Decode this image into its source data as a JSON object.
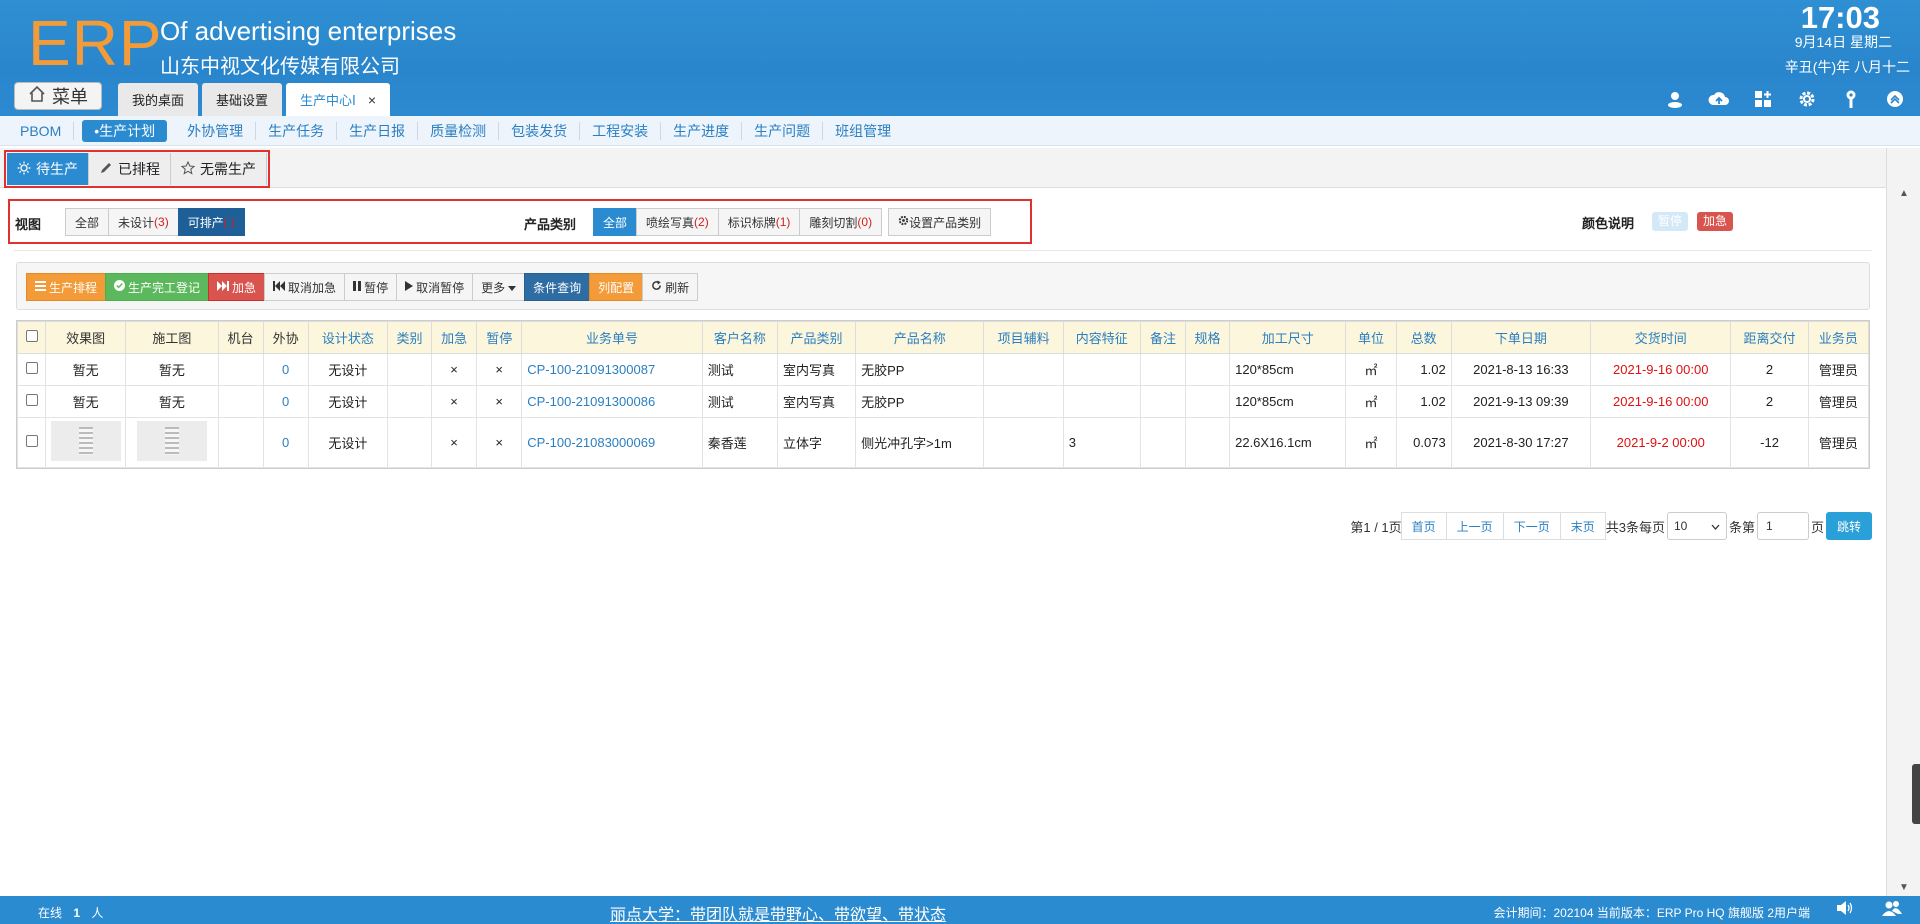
{
  "header": {
    "logo": "ERP",
    "app_title": "Of advertising enterprises",
    "company": "山东中视文化传媒有限公司",
    "clock": "17:03",
    "date": "9月14日 星期二",
    "lunar_date": "辛丑(牛)年 八月十二",
    "menu_label": "菜单"
  },
  "tabs": [
    {
      "label": "我的桌面"
    },
    {
      "label": "基础设置"
    },
    {
      "label": "生产中心Ⅰ",
      "close": "×"
    }
  ],
  "subnav": [
    "PBOM",
    "•生产计划",
    "外协管理",
    "生产任务",
    "生产日报",
    "质量检测",
    "包装发货",
    "工程安装",
    "生产进度",
    "生产问题",
    "班组管理"
  ],
  "status_tabs": [
    "待生产",
    "已排程",
    "无需生产"
  ],
  "filters": {
    "view_label": "视图",
    "view_all": "全部",
    "view_undesigned": "未设计",
    "view_undesigned_count": "(3)",
    "view_producible": "可排产",
    "view_producible_count": "( )",
    "category_label": "产品类别",
    "cat_all": "全部",
    "cat_1": "喷绘写真",
    "cat_1_count": "(2)",
    "cat_2": "标识标牌",
    "cat_2_count": "(1)",
    "cat_3": "雕刻切割",
    "cat_3_count": "(0)",
    "set_category": "设置产品类别",
    "color_legend_label": "颜色说明",
    "legend_paused": "暂停",
    "legend_urgent": "加急"
  },
  "toolbar": {
    "schedule": "生产排程",
    "complete": "生产完工登记",
    "urgent": "加急",
    "cancel_urgent": "取消加急",
    "pause": "暂停",
    "cancel_pause": "取消暂停",
    "more": "更多",
    "query": "条件查询",
    "columns": "列配置",
    "refresh": "刷新"
  },
  "table": {
    "columns": [
      "效果图",
      "施工图",
      "机台",
      "外协",
      "设计状态",
      "类别",
      "加急",
      "暂停",
      "业务单号",
      "客户名称",
      "产品类别",
      "产品名称",
      "项目辅料",
      "内容特征",
      "备注",
      "规格",
      "加工尺寸",
      "单位",
      "总数",
      "下单日期",
      "交货时间",
      "距离交付",
      "业务员"
    ],
    "rows": [
      {
        "effect": "暂无",
        "construction": "暂无",
        "machine": "",
        "outsource": "0",
        "design": "无设计",
        "type": "",
        "urgent": "×",
        "pause": "×",
        "order_no": "CP-100-21091300087",
        "customer": "测试",
        "category": "室内写真",
        "product": "无胶PP",
        "material": "",
        "content": "",
        "remark": "",
        "spec": "",
        "size": "120*85cm",
        "unit": "㎡",
        "total": "1.02",
        "order_date": "2021-8-13 16:33",
        "delivery": "2021-9-16 00:00",
        "days": "2",
        "salesman": "管理员"
      },
      {
        "effect": "暂无",
        "construction": "暂无",
        "machine": "",
        "outsource": "0",
        "design": "无设计",
        "type": "",
        "urgent": "×",
        "pause": "×",
        "order_no": "CP-100-21091300086",
        "customer": "测试",
        "category": "室内写真",
        "product": "无胶PP",
        "material": "",
        "content": "",
        "remark": "",
        "spec": "",
        "size": "120*85cm",
        "unit": "㎡",
        "total": "1.02",
        "order_date": "2021-9-13 09:39",
        "delivery": "2021-9-16 00:00",
        "days": "2",
        "salesman": "管理员"
      },
      {
        "effect": "",
        "construction": "",
        "machine": "",
        "outsource": "0",
        "design": "无设计",
        "type": "",
        "urgent": "×",
        "pause": "×",
        "order_no": "CP-100-21083000069",
        "customer": "秦香莲",
        "category": "立体字",
        "product": "侧光冲孔字>1m",
        "material": "",
        "content": "3",
        "remark": "",
        "spec": "",
        "size": "22.6X16.1cm",
        "unit": "㎡",
        "total": "0.073",
        "order_date": "2021-8-30 17:27",
        "delivery": "2021-9-2 00:00",
        "days": "-12",
        "salesman": "管理员"
      }
    ]
  },
  "pagination": {
    "page_info": "第1 / 1页",
    "first": "首页",
    "prev": "上一页",
    "next": "下一页",
    "last": "末页",
    "total_info": "共3条每页",
    "page_size": "10",
    "jump_prefix": "条第",
    "page_input": "1",
    "page_suffix": "页",
    "go": "跳转"
  },
  "footer": {
    "online_label": "在线",
    "online_count": "1",
    "online_unit": "人",
    "motto": "丽点大学：带团队就是带野心、带欲望、带状态",
    "info": "会计期间：202104 当前版本：ERP Pro HQ 旗舰版 2用户端"
  },
  "colors": {
    "primary": "#2a8bd0",
    "logo": "#f29b38",
    "danger": "#e01010"
  }
}
